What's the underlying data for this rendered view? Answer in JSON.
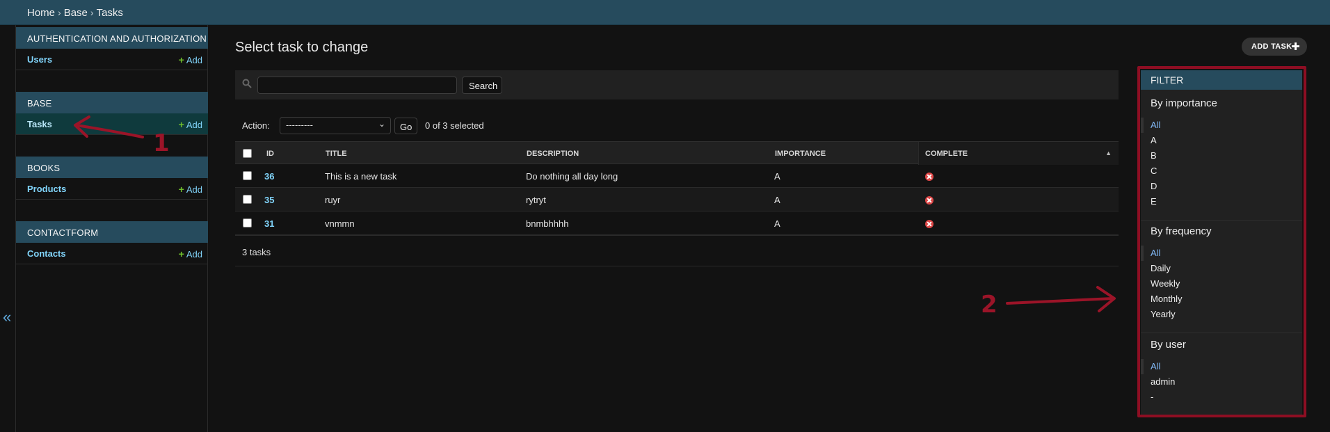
{
  "breadcrumbs": [
    "Home",
    "Base",
    "Tasks"
  ],
  "breadcrumb_sep": "›",
  "sidebar": {
    "modules": [
      {
        "header": "Authentication and Authorization",
        "items": [
          {
            "label": "Users",
            "add": "Add"
          }
        ]
      },
      {
        "header": "Base",
        "items": [
          {
            "label": "Tasks",
            "add": "Add",
            "active": true
          }
        ]
      },
      {
        "header": "Books",
        "items": [
          {
            "label": "Products",
            "add": "Add"
          }
        ]
      },
      {
        "header": "Contactform",
        "items": [
          {
            "label": "Contacts",
            "add": "Add"
          }
        ]
      }
    ],
    "collapse_glyph": "«"
  },
  "main": {
    "title": "Select task to change",
    "add_button": "ADD TASK",
    "search_button": "Search",
    "search_value": "",
    "action_label": "Action:",
    "action_selected": "---------",
    "go_button": "Go",
    "selected_count": "0 of 3 selected",
    "columns": [
      "ID",
      "Title",
      "Description",
      "Importance",
      "Complete"
    ],
    "rows": [
      {
        "id": "36",
        "title": "This is a new task",
        "description": "Do nothing all day long",
        "importance": "A",
        "complete": false
      },
      {
        "id": "35",
        "title": "ruyr",
        "description": "rytryt",
        "importance": "A",
        "complete": false
      },
      {
        "id": "31",
        "title": "vnmmn",
        "description": "bnmbhhhh",
        "importance": "A",
        "complete": false
      }
    ],
    "paginator": "3 tasks"
  },
  "filter": {
    "title": "FILTER",
    "sections": [
      {
        "title": "By importance",
        "options": [
          "All",
          "A",
          "B",
          "C",
          "D",
          "E"
        ],
        "selected": "All"
      },
      {
        "title": "By frequency",
        "options": [
          "All",
          "Daily",
          "Weekly",
          "Monthly",
          "Yearly"
        ],
        "selected": "All"
      },
      {
        "title": "By user",
        "options": [
          "All",
          "admin",
          "-"
        ],
        "selected": "All"
      }
    ]
  },
  "annotations": {
    "first": "1",
    "second": "2",
    "color": "#9b1428"
  },
  "colors": {
    "header_bg": "#264b5d",
    "link": "#81d4fa",
    "add_plus": "#70bf2b",
    "complete_false": "#dd4646"
  }
}
